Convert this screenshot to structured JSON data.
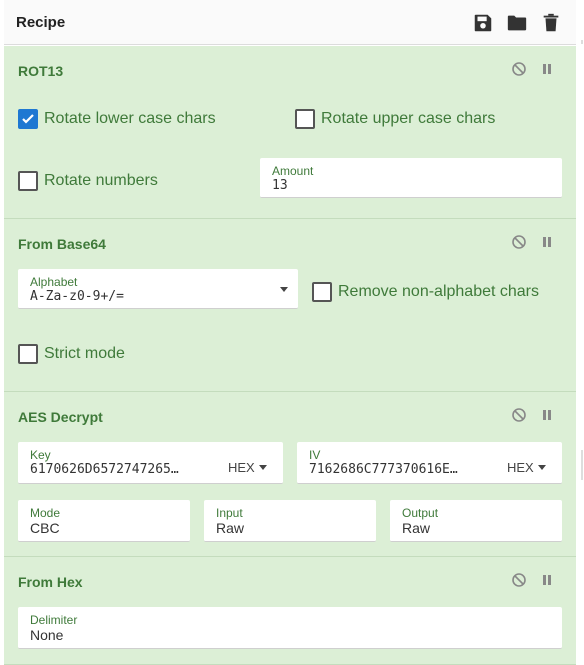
{
  "header": {
    "title": "Recipe",
    "icons": [
      "save-icon",
      "folder-icon",
      "trash-icon"
    ]
  },
  "colors": {
    "op_bg": "#dcefd6",
    "accent_green": "#3f7a3a",
    "check_blue": "#1e78d2"
  },
  "ops": {
    "rot13": {
      "title": "ROT13",
      "lower_label": "Rotate lower case chars",
      "lower_checked": true,
      "upper_label": "Rotate upper case chars",
      "upper_checked": false,
      "numbers_label": "Rotate numbers",
      "numbers_checked": false,
      "amount_label": "Amount",
      "amount_value": "13"
    },
    "base64": {
      "title": "From Base64",
      "alphabet_label": "Alphabet",
      "alphabet_value": "A-Za-z0-9+/=",
      "remove_label": "Remove non-alphabet chars",
      "remove_checked": false,
      "strict_label": "Strict mode",
      "strict_checked": false
    },
    "aes": {
      "title": "AES Decrypt",
      "key_label": "Key",
      "key_value": "6170626D6572747265…",
      "key_format": "HEX",
      "iv_label": "IV",
      "iv_value": "7162686C777370616E…",
      "iv_format": "HEX",
      "mode_label": "Mode",
      "mode_value": "CBC",
      "input_label": "Input",
      "input_value": "Raw",
      "output_label": "Output",
      "output_value": "Raw"
    },
    "fromhex": {
      "title": "From Hex",
      "delimiter_label": "Delimiter",
      "delimiter_value": "None"
    }
  }
}
